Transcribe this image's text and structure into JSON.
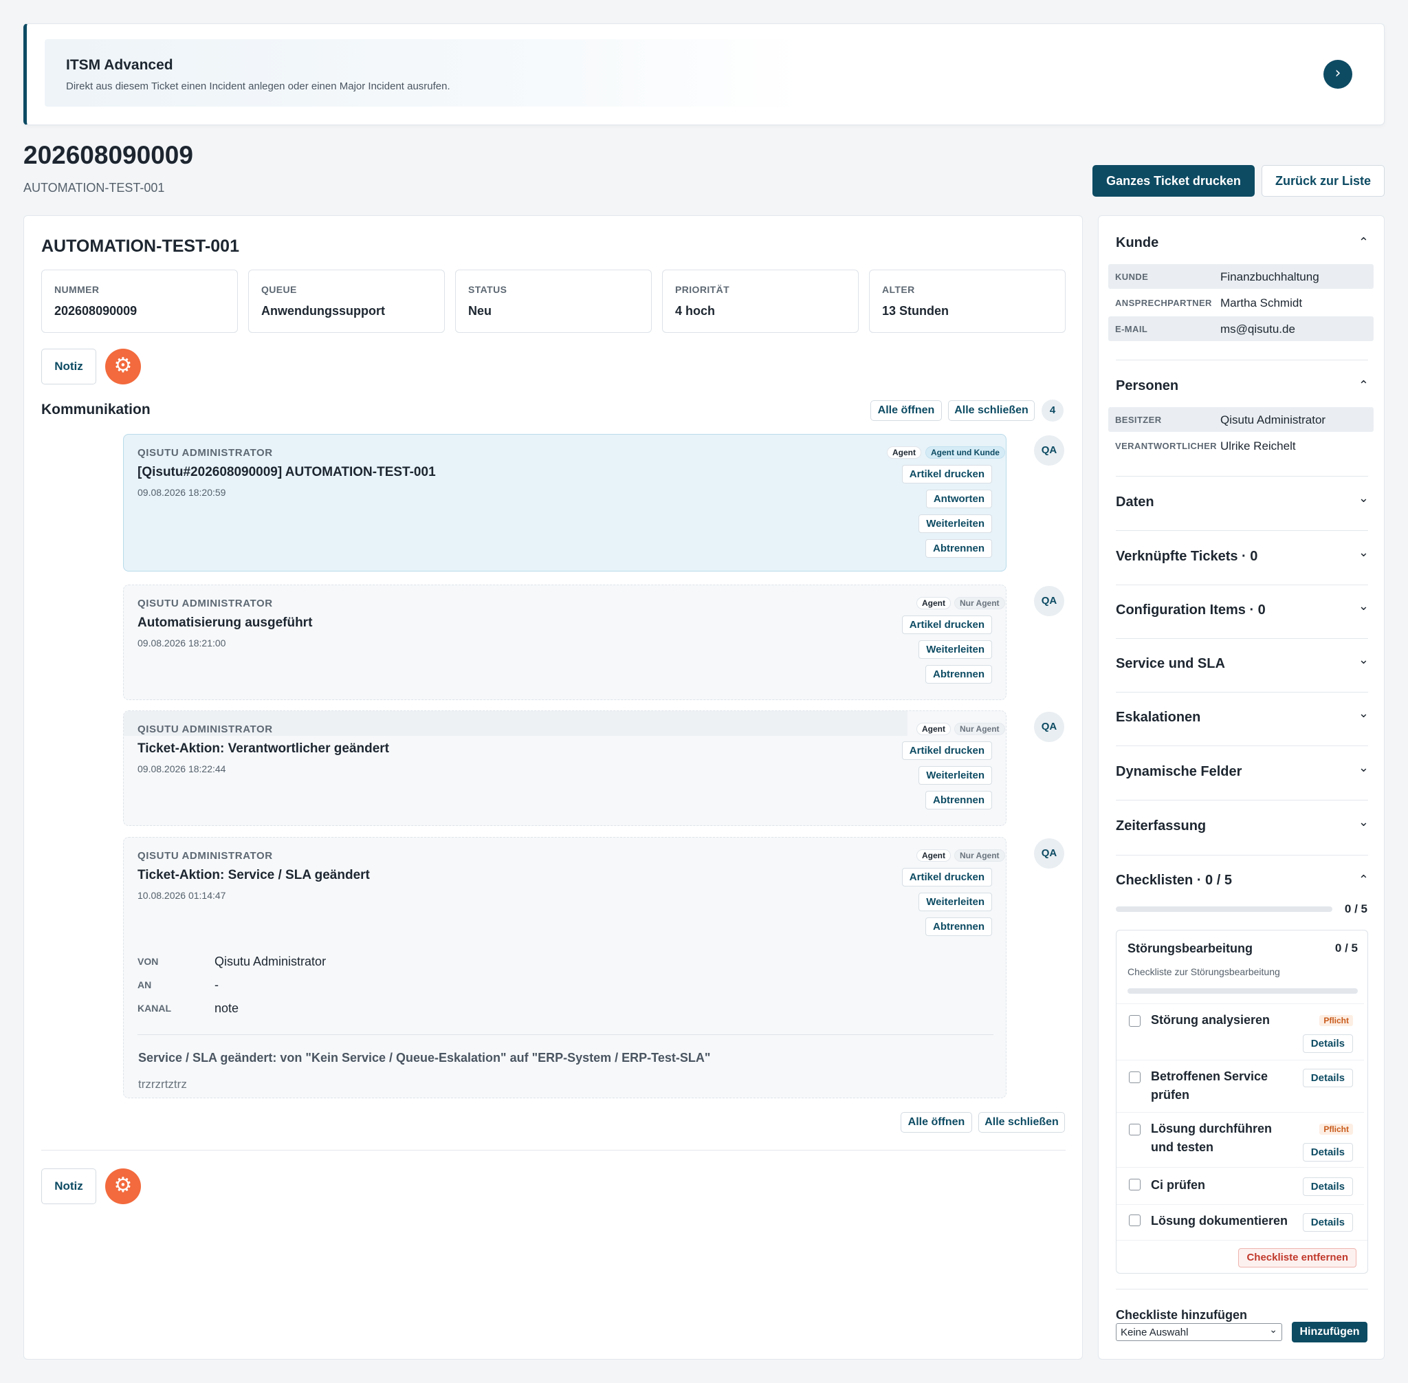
{
  "banner": {
    "title": "ITSM Advanced",
    "subtitle": "Direkt aus diesem Ticket einen Incident anlegen oder einen Major Incident ausrufen.",
    "arrow": "›"
  },
  "ticket": {
    "number": "202608090009",
    "title": "AUTOMATION-TEST-001"
  },
  "header_actions": {
    "print": "Ganzes Ticket drucken",
    "back": "Zurück zur Liste"
  },
  "main": {
    "title": "AUTOMATION-TEST-001",
    "info": [
      {
        "label": "NUMMER",
        "value": "202608090009"
      },
      {
        "label": "QUEUE",
        "value": "Anwendungssupport"
      },
      {
        "label": "STATUS",
        "value": "Neu"
      },
      {
        "label": "PRIORITÄT",
        "value": "4 hoch"
      },
      {
        "label": "ALTER",
        "value": "13 Stunden"
      }
    ],
    "note_label": "Notiz",
    "gear_glyph": "⚙",
    "communication": {
      "title": "Kommunikation",
      "open_all": "Alle öffnen",
      "close_all": "Alle schließen",
      "count": "4"
    },
    "articles": [
      {
        "sender": "QISUTU ADMINISTRATOR",
        "subject": "[Qisutu#202608090009] AUTOMATION-TEST-001",
        "time": "09.08.2026 18:20:59",
        "tag_role": "Agent",
        "tag_visibility": "Agent und Kunde",
        "actions": [
          "Artikel drucken",
          "Antworten",
          "Weiterleiten",
          "Abtrennen"
        ],
        "avatar": "QA"
      },
      {
        "sender": "QISUTU ADMINISTRATOR",
        "subject": "Automatisierung ausgeführt",
        "time": "09.08.2026 18:21:00",
        "tag_role": "Agent",
        "tag_visibility": "Nur Agent",
        "actions": [
          "Artikel drucken",
          "Weiterleiten",
          "Abtrennen"
        ],
        "avatar": "QA"
      },
      {
        "sender": "QISUTU ADMINISTRATOR",
        "subject": "Ticket-Aktion: Verantwortlicher geändert",
        "time": "09.08.2026 18:22:44",
        "tag_role": "Agent",
        "tag_visibility": "Nur Agent",
        "actions": [
          "Artikel drucken",
          "Weiterleiten",
          "Abtrennen"
        ],
        "avatar": "QA"
      },
      {
        "sender": "QISUTU ADMINISTRATOR",
        "subject": "Ticket-Aktion: Service / SLA geändert",
        "time": "10.08.2026 01:14:47",
        "tag_role": "Agent",
        "tag_visibility": "Nur Agent",
        "actions": [
          "Artikel drucken",
          "Weiterleiten",
          "Abtrennen"
        ],
        "avatar": "QA",
        "meta": [
          {
            "label": "VON",
            "value": "Qisutu Administrator"
          },
          {
            "label": "AN",
            "value": "-"
          },
          {
            "label": "KANAL",
            "value": "note"
          }
        ],
        "body_headline": "Service / SLA geändert: von \"Kein Service / Queue-Eskalation\" auf \"ERP-System / ERP-Test-SLA\"",
        "body_text": "trzrzrtztrz"
      }
    ]
  },
  "sidebar": {
    "kunde": {
      "title": "Kunde",
      "rows": [
        {
          "label": "KUNDE",
          "value": "Finanzbuchhaltung"
        },
        {
          "label": "ANSPRECHPARTNER",
          "value": "Martha Schmidt"
        },
        {
          "label": "E-MAIL",
          "value": "ms@qisutu.de"
        }
      ]
    },
    "personen": {
      "title": "Personen",
      "rows": [
        {
          "label": "BESITZER",
          "value": "Qisutu Administrator"
        },
        {
          "label": "VERANTWORTLICHER",
          "value": "Ulrike Reichelt"
        }
      ]
    },
    "collapsed_sections": [
      "Daten",
      "Verknüpfte Tickets · 0",
      "Configuration Items · 0",
      "Service und SLA",
      "Eskalationen",
      "Dynamische Felder",
      "Zeiterfassung"
    ],
    "checklists": {
      "title": "Checklisten · 0 / 5",
      "progress_text": "0 / 5",
      "progress": 0,
      "card": {
        "title": "Störungsbearbeitung",
        "count": "0 / 5",
        "description": "Checkliste zur Störungsbearbeitung",
        "items": [
          {
            "label": "Störung analysieren",
            "required": "Pflicht",
            "details": "Details"
          },
          {
            "label": "Betroffenen Service prüfen",
            "required": "",
            "details": "Details"
          },
          {
            "label": "Lösung durchführen und testen",
            "required": "Pflicht",
            "details": "Details"
          },
          {
            "label": "Ci prüfen",
            "required": "",
            "details": "Details"
          },
          {
            "label": "Lösung dokumentieren",
            "required": "",
            "details": "Details"
          }
        ],
        "remove": "Checkliste entfernen"
      },
      "add": {
        "title": "Checkliste hinzufügen",
        "select_value": "Keine Auswahl",
        "button": "Hinzufügen"
      }
    },
    "chevron_up": "⌃",
    "chevron_down": "⌄"
  },
  "colors": {
    "primary": "#0d4b63",
    "accent_orange": "#f26a3d",
    "danger": "#c0392b"
  }
}
